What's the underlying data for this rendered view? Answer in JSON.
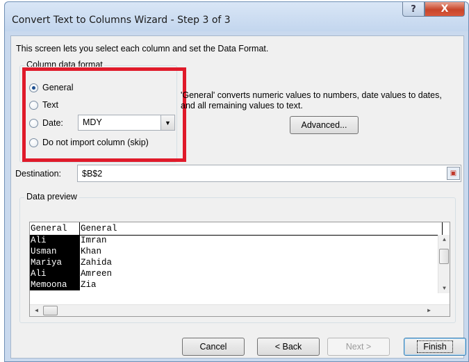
{
  "window": {
    "title": "Convert Text to Columns Wizard - Step 3 of 3",
    "help_glyph": "?",
    "close_glyph": "X"
  },
  "intro_text": "This screen lets you select each column and set the Data Format.",
  "column_format": {
    "group_label": "Column data format",
    "options": [
      {
        "label": "General",
        "checked": true
      },
      {
        "label": "Text",
        "checked": false
      },
      {
        "label": "Date:",
        "checked": false
      },
      {
        "label": "Do not import column (skip)",
        "checked": false
      }
    ],
    "date_value": "MDY"
  },
  "description": "'General' converts numeric values to numbers, date values to dates, and all remaining values to text.",
  "advanced_label": "Advanced...",
  "destination": {
    "label": "Destination:",
    "value": "$B$2"
  },
  "preview": {
    "label": "Data preview",
    "headers": [
      "General",
      "General"
    ],
    "rows": [
      [
        "Ali",
        "Imran"
      ],
      [
        "Usman",
        "Khan"
      ],
      [
        "Mariya",
        "Zahida"
      ],
      [
        "Ali",
        "Amreen"
      ],
      [
        "Memoona",
        "Zia"
      ]
    ]
  },
  "buttons": {
    "cancel": "Cancel",
    "back": "< Back",
    "next": "Next >",
    "finish": "Finish"
  },
  "colors": {
    "highlight": "#e01a2a",
    "close_button": "#c8452a",
    "titlebar": "#c9d9ee"
  }
}
